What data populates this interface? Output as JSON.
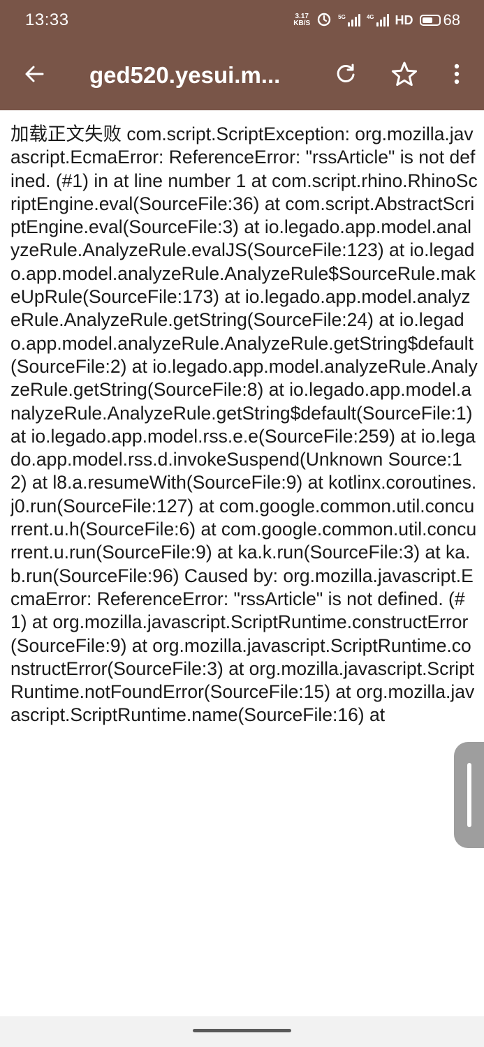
{
  "status_bar": {
    "time": "13:33",
    "net_speed_value": "3.17",
    "net_speed_unit": "KB/S",
    "sig1_label": "5G",
    "sig2_label": "4G",
    "hd_label": "HD",
    "battery_level": "68",
    "icons": [
      "alarm-icon",
      "signal-icon",
      "battery-icon"
    ]
  },
  "toolbar": {
    "title": "ged520.yesui.m...",
    "icons": [
      "back-arrow-icon",
      "refresh-icon",
      "star-outline-icon",
      "more-vert-icon"
    ]
  },
  "content": {
    "text": "加载正文失败 com.script.ScriptException: org.mozilla.javascript.EcmaError: ReferenceError: \"rssArticle\" is not defined. (#1) in at line number 1 at com.script.rhino.RhinoScriptEngine.eval(SourceFile:36) at com.script.AbstractScriptEngine.eval(SourceFile:3) at io.legado.app.model.analyzeRule.AnalyzeRule.evalJS(SourceFile:123) at io.legado.app.model.analyzeRule.AnalyzeRule$SourceRule.makeUpRule(SourceFile:173) at io.legado.app.model.analyzeRule.AnalyzeRule.getString(SourceFile:24) at io.legado.app.model.analyzeRule.AnalyzeRule.getString$default(SourceFile:2) at io.legado.app.model.analyzeRule.AnalyzeRule.getString(SourceFile:8) at io.legado.app.model.analyzeRule.AnalyzeRule.getString$default(SourceFile:1) at io.legado.app.model.rss.e.e(SourceFile:259) at io.legado.app.model.rss.d.invokeSuspend(Unknown Source:12) at l8.a.resumeWith(SourceFile:9) at kotlinx.coroutines.j0.run(SourceFile:127) at com.google.common.util.concurrent.u.h(SourceFile:6) at com.google.common.util.concurrent.u.run(SourceFile:9) at ka.k.run(SourceFile:3) at ka.b.run(SourceFile:96) Caused by: org.mozilla.javascript.EcmaError: ReferenceError: \"rssArticle\" is not defined. (#1) at org.mozilla.javascript.ScriptRuntime.constructError(SourceFile:9) at org.mozilla.javascript.ScriptRuntime.constructError(SourceFile:3) at org.mozilla.javascript.ScriptRuntime.notFoundError(SourceFile:15) at org.mozilla.javascript.ScriptRuntime.name(SourceFile:16) at"
  },
  "colors": {
    "primary": "#795548",
    "on_primary": "#ffffff",
    "text": "#1a1a1a",
    "scroller": "#9e9e9e"
  }
}
